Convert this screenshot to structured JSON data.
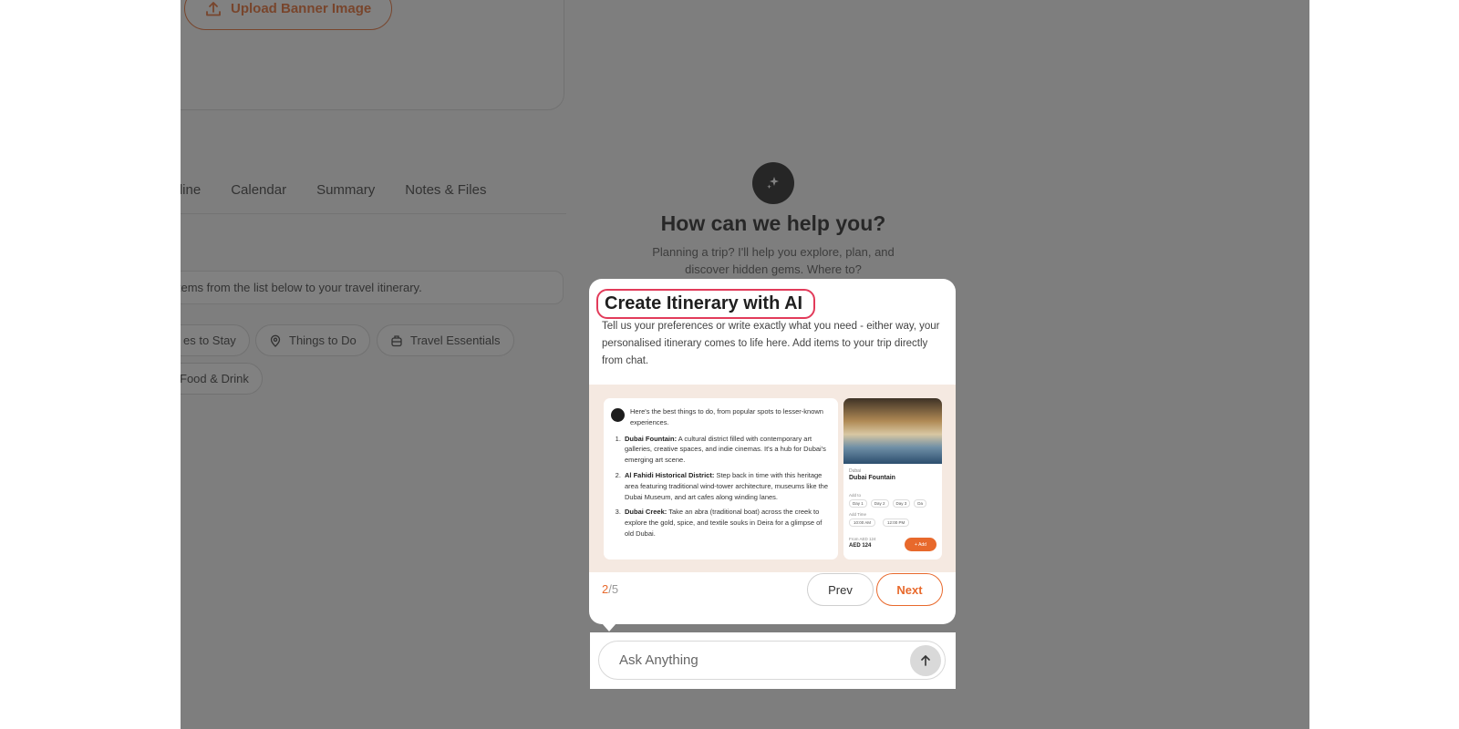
{
  "background": {
    "upload_banner_label": "Upload Banner Image",
    "tabs": [
      "meline",
      "Calendar",
      "Summary",
      "Notes & Files"
    ],
    "info_text": "items from the list below to your travel itinerary.",
    "chips": {
      "places_to_stay": "es to Stay",
      "things_to_do": "Things to Do",
      "travel_essentials": "Travel Essentials",
      "food_drink": "Food & Drink"
    },
    "assistant": {
      "title": "How can we help you?",
      "subtitle": "Planning a trip? I'll help you explore, plan, and discover hidden gems. Where to?"
    }
  },
  "tour": {
    "title": "Create Itinerary with AI",
    "description": "Tell us your preferences or write exactly what you need - either way, your personalised itinerary comes to life here. Add items to your trip directly from chat.",
    "step_current": "2",
    "step_total": "/5",
    "prev_label": "Prev",
    "next_label": "Next",
    "preview": {
      "intro": "Here's the best things to do, from popular spots to lesser-known experiences.",
      "items": [
        {
          "name": "Dubai Fountain:",
          "text": "A cultural district filled with contemporary art galleries, creative spaces, and indie cinemas. It's a hub for Dubai's emerging art scene."
        },
        {
          "name": "Al Fahidi Historical District:",
          "text": "Step back in time with this heritage area featuring traditional wind-tower architecture, museums like the Dubai Museum, and art cafes along winding lanes."
        },
        {
          "name": "Dubai Creek:",
          "text": "Take an abra (traditional boat) across the creek to explore the gold, spice, and textile souks in Deira for a glimpse of old Dubai."
        }
      ],
      "card": {
        "location": "Dubai",
        "place": "Dubai Fountain",
        "day_label": "Add to",
        "days": [
          "Day 1",
          "Day 2",
          "Day 3",
          "Da"
        ],
        "time_label": "Add Time",
        "times": [
          "10:00 AM",
          "12:00 PM"
        ],
        "from_label": "From AED 124",
        "price": "AED 124",
        "add_label": "+ Add"
      }
    }
  },
  "chat": {
    "placeholder": "Ask Anything"
  },
  "colors": {
    "accent": "#e8692c",
    "highlight": "#e23b5a"
  }
}
